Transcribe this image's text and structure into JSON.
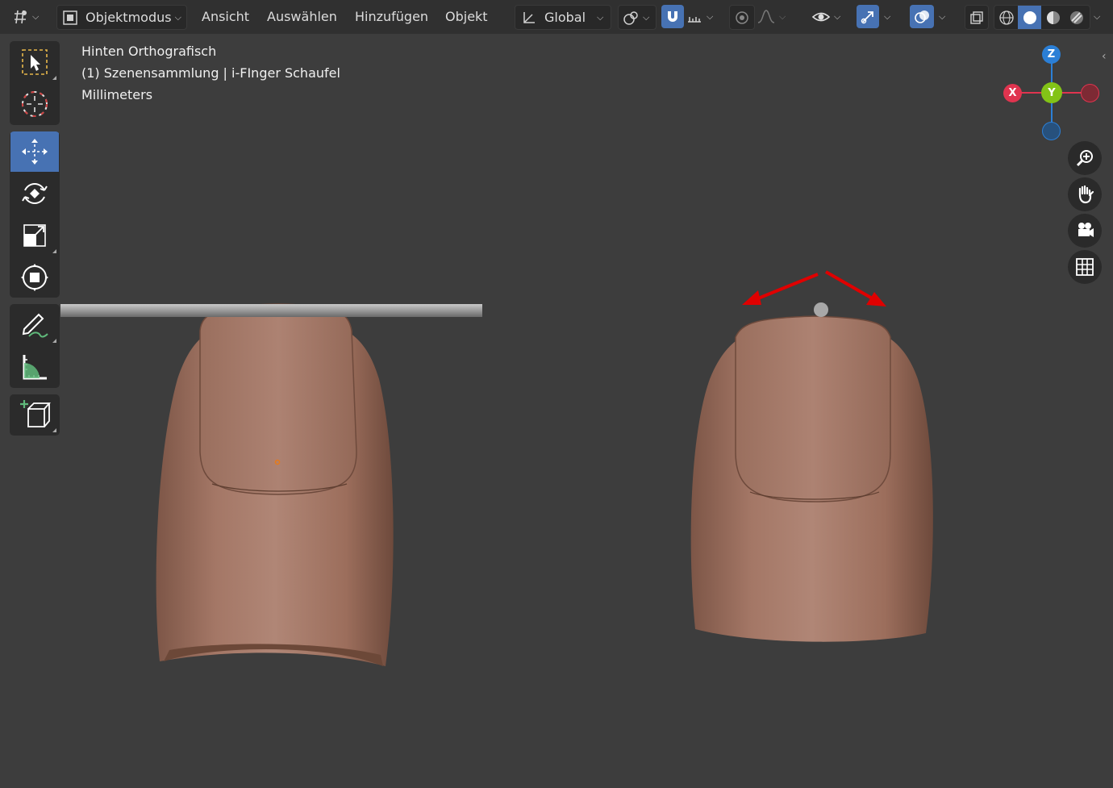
{
  "header": {
    "mode_label": "Objektmodus",
    "menus": [
      "Ansicht",
      "Auswählen",
      "Hinzufügen",
      "Objekt"
    ],
    "transform_orientation": "Global"
  },
  "viewport": {
    "view_name": "Hinten Orthografisch",
    "collection_info": "(1) Szenensammlung | i-FInger Schaufel",
    "units": "Millimeters"
  },
  "gizmo": {
    "z": "Z",
    "y": "Y",
    "x": "X"
  },
  "colors": {
    "active_blue": "#4772b3",
    "axis_x": "#e0344f",
    "axis_y": "#83c317",
    "axis_z": "#2b7fd6",
    "annotation_red": "#e00000",
    "skin": "#a87a66"
  },
  "toolbar_icons": [
    "select-box-icon",
    "cursor-icon",
    "move-icon",
    "rotate-icon",
    "scale-icon",
    "transform-icon",
    "annotate-icon",
    "measure-icon",
    "add-cube-icon"
  ]
}
